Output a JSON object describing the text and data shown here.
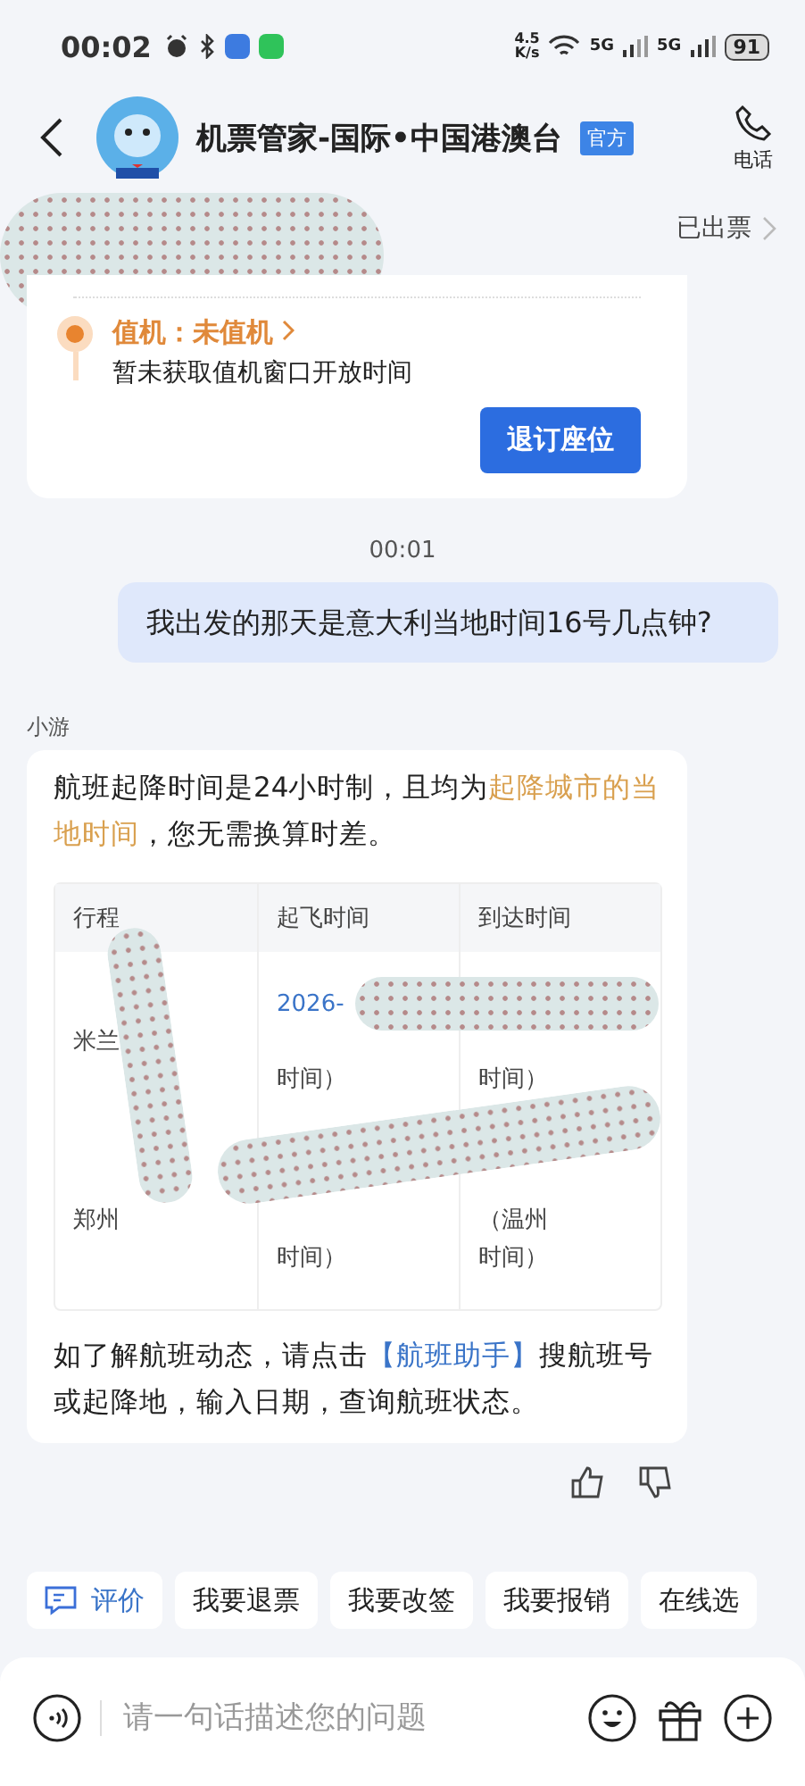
{
  "status_bar": {
    "time": "00:02",
    "speed": "4.5",
    "speed_unit": "K/s",
    "network_1": "5G",
    "network_2": "5G",
    "battery": "91"
  },
  "header": {
    "title": "机票管家-国际•中国港澳台",
    "badge": "官方",
    "phone_label": "电话"
  },
  "order": {
    "status": "已出票",
    "checkin_title": "值机：未值机",
    "checkin_note": "暂未获取值机窗口开放时间",
    "button": "退订座位"
  },
  "timestamp": "00:01",
  "user_message": "我出发的那天是意大利当地时间16号几点钟?",
  "bot": {
    "name": "小游",
    "intro": [
      {
        "kind": "plain",
        "text": "航班起降时间是24小时制，且均为"
      },
      {
        "kind": "highlight",
        "text": "起降城市的当地时间"
      },
      {
        "kind": "plain",
        "text": "，您无需换算时差。"
      }
    ],
    "table": {
      "columns": [
        "行程",
        "起飞时间",
        "到达时间"
      ],
      "rows": [
        {
          "cells": [
            [
              "米兰"
            ],
            [
              "2026-",
              "",
              "时间）"
            ],
            [
              "",
              "",
              "时间）"
            ]
          ]
        },
        {
          "cells": [
            [
              "郑州"
            ],
            [
              "",
              "",
              "时间）"
            ],
            [
              "",
              "（温州",
              "时间）"
            ]
          ]
        }
      ]
    },
    "outro": [
      {
        "kind": "plain",
        "text": "如了解航班动态，请点击"
      },
      {
        "kind": "link",
        "text": "【航班助手】"
      },
      {
        "kind": "plain",
        "text": "搜航班号或起降地，输入日期，查询航班状态。"
      }
    ]
  },
  "quick_replies": [
    {
      "kind": "rate",
      "label": "评价"
    },
    {
      "kind": "plain",
      "label": "我要退票"
    },
    {
      "kind": "plain",
      "label": "我要改签"
    },
    {
      "kind": "plain",
      "label": "我要报销"
    },
    {
      "kind": "plain",
      "label": "在线选"
    }
  ],
  "input": {
    "placeholder": "请一句话描述您的问题"
  }
}
